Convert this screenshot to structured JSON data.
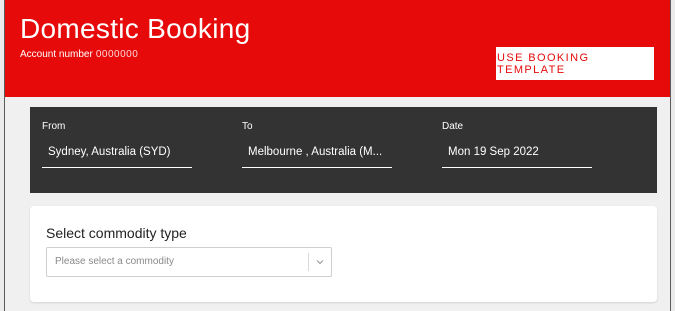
{
  "header": {
    "title": "Domestic Booking",
    "account_label": "Account number",
    "account_number": "0000000",
    "template_button": "USE BOOKING TEMPLATE"
  },
  "search": {
    "from_label": "From",
    "from_value": "Sydney, Australia (SYD)",
    "to_label": "To",
    "to_value": "Melbourne , Australia (M...",
    "date_label": "Date",
    "date_value": "Mon 19 Sep 2022"
  },
  "commodity": {
    "title": "Select commodity type",
    "placeholder": "Please select a commodity"
  },
  "colors": {
    "brand_red": "#e60a0a",
    "search_bar": "#333333",
    "page_bg": "#f0f0f0"
  },
  "icons": {
    "select_caret": "chevron-down-icon"
  }
}
